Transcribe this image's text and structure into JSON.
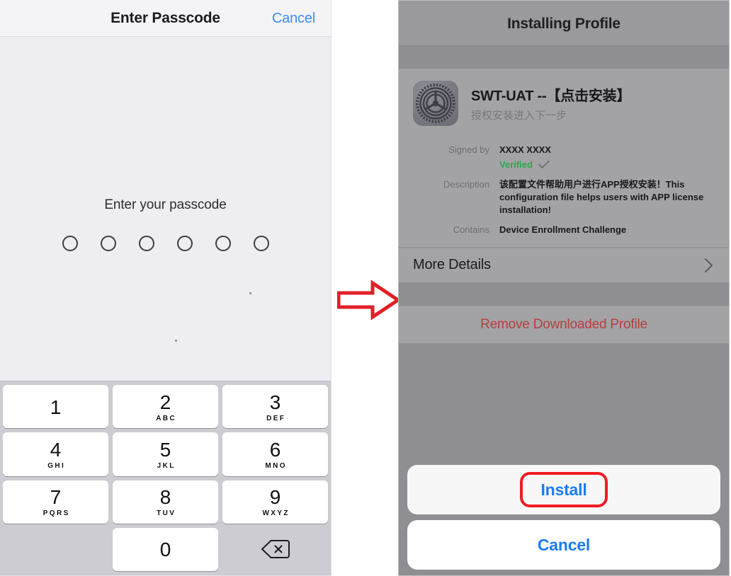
{
  "passcode_screen": {
    "navbar": {
      "title": "Enter Passcode",
      "cancel_label": "Cancel",
      "cancel_color": "#3b8cf5"
    },
    "prompt": "Enter your passcode",
    "dot_count": 6,
    "keypad": {
      "keys": [
        {
          "digit": "1",
          "letters": ""
        },
        {
          "digit": "2",
          "letters": "ABC"
        },
        {
          "digit": "3",
          "letters": "DEF"
        },
        {
          "digit": "4",
          "letters": "GHI"
        },
        {
          "digit": "5",
          "letters": "JKL"
        },
        {
          "digit": "6",
          "letters": "MNO"
        },
        {
          "digit": "7",
          "letters": "PQRS"
        },
        {
          "digit": "8",
          "letters": "TUV"
        },
        {
          "digit": "9",
          "letters": "WXYZ"
        },
        {
          "digit": "0",
          "letters": ""
        }
      ],
      "delete_icon": "delete-backward-icon"
    }
  },
  "arrow": {
    "icon": "right-arrow-annotation-icon",
    "color": "#e21f26"
  },
  "profile_screen": {
    "navbar": {
      "title": "Installing Profile"
    },
    "profile": {
      "icon": "settings-gear-icon",
      "name": "SWT-UAT --【点击安装】",
      "subtitle": "授权安装进入下一步"
    },
    "details": [
      {
        "label": "Signed by",
        "value": "XXXX XXXX",
        "verified_text": "Verified",
        "verified_icon": "checkmark-icon",
        "verified_color": "#2aa84f"
      },
      {
        "label": "Description",
        "value": "该配置文件帮助用户进行APP授权安装！This configuration file helps users with APP license installation!"
      },
      {
        "label": "Contains",
        "value": "Device Enrollment Challenge"
      }
    ],
    "more_details": {
      "label": "More Details",
      "chevron_icon": "chevron-right-icon"
    },
    "remove_profile": {
      "label": "Remove Downloaded Profile",
      "color": "#b4403f"
    },
    "actions": {
      "install_label": "Install",
      "cancel_label": "Cancel",
      "accent_color": "#1b7cf0",
      "highlight_color": "#ef1c22"
    }
  }
}
